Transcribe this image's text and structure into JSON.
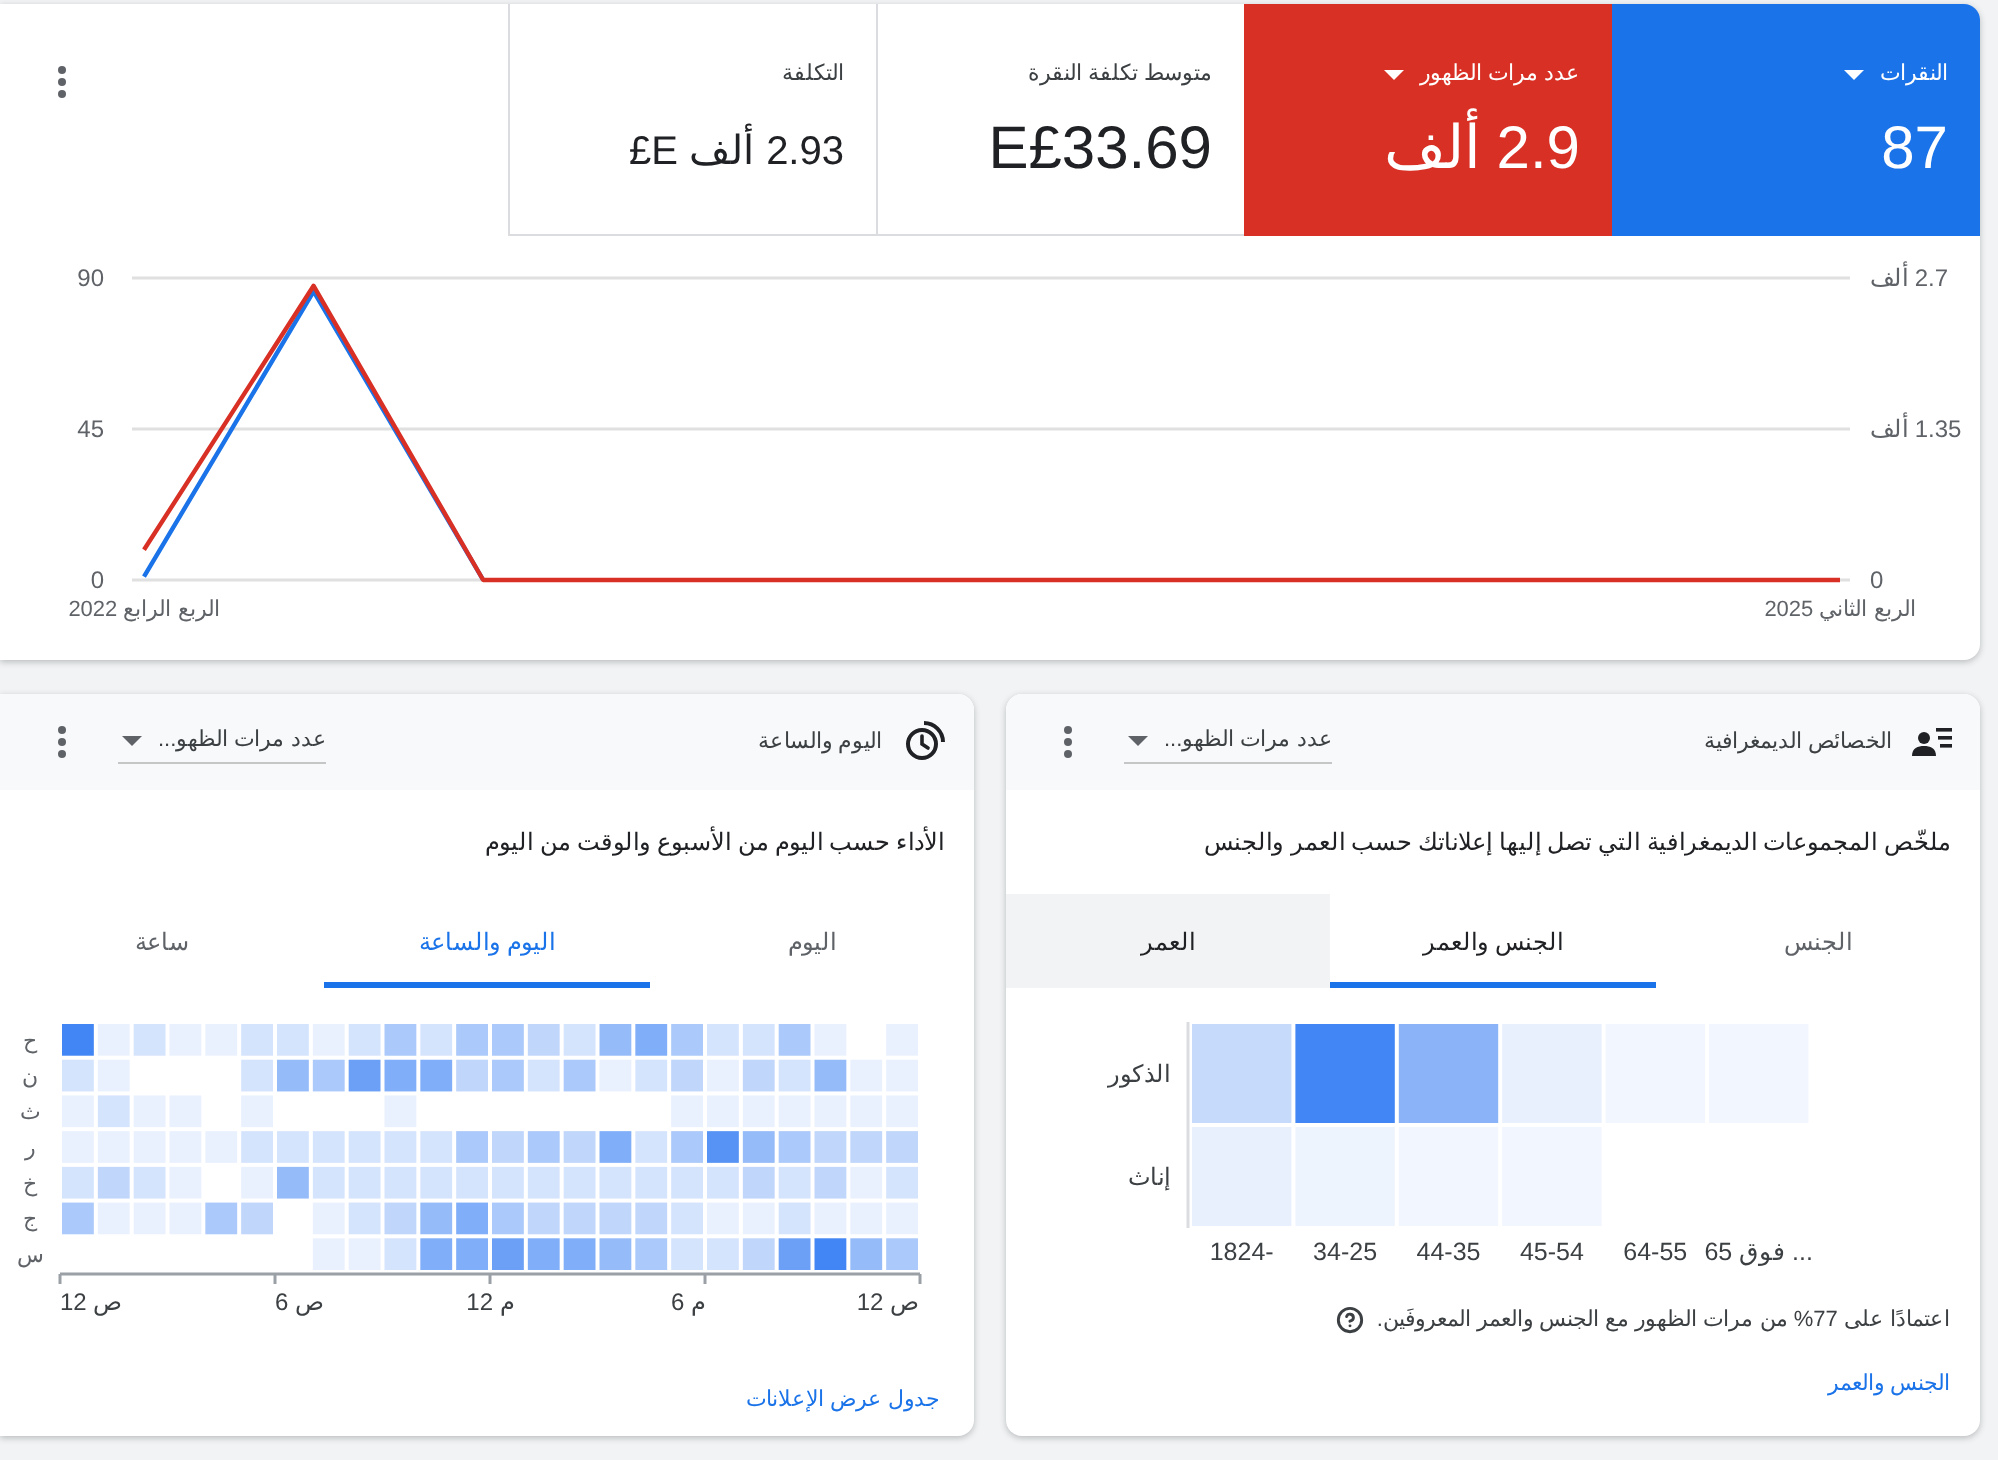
{
  "overview": {
    "metrics": [
      {
        "label": "النقرات",
        "value": "87",
        "selected": true,
        "color": "#1a73e8"
      },
      {
        "label": "عدد مرات الظهور",
        "value": "2.9 ألف",
        "selected": true,
        "color": "#d93025"
      },
      {
        "label": "متوسط تكلفة النقرة",
        "value": "E£33.69",
        "selected": false
      },
      {
        "label": "التكلفة",
        "value": "2.93 ألف E£",
        "selected": false
      }
    ],
    "chart_data": {
      "type": "line",
      "categories": [
        "الربع الرابع 2022",
        null,
        null,
        null,
        null,
        null,
        null,
        null,
        null,
        null,
        "الربع الثاني 2025"
      ],
      "ylim": [
        0,
        90
      ],
      "yticks": [
        0,
        45,
        90
      ],
      "y2lim": [
        0,
        2.7
      ],
      "y2ticks": [
        0,
        {
          "value": 1.35,
          "label": "1.35 ألف"
        },
        {
          "value": 2.7,
          "label": "2.7 ألف"
        }
      ],
      "series": [
        {
          "color": "#1a73e8",
          "values": [
            1,
            86,
            0,
            null,
            null,
            null,
            null,
            null,
            null,
            null,
            null
          ]
        },
        {
          "color": "#d93025",
          "axis": "y2",
          "values": [
            0.27,
            2.63,
            0,
            0,
            0,
            0,
            0,
            0,
            0,
            0,
            0
          ]
        }
      ]
    }
  },
  "demographics": {
    "title": "الخصائص الديمغرافية",
    "metric_dropdown": "عدد مرات الظهو...",
    "description": "ملخّص المجموعات الديمغرافية التي تصل إليها إعلاناتك حسب العمر والجنس",
    "tabs": [
      {
        "label": "الجنس",
        "selected": false,
        "hovered": false
      },
      {
        "label": "الجنس والعمر",
        "selected": true,
        "hovered": false
      },
      {
        "label": "العمر",
        "selected": false,
        "hovered": true
      }
    ],
    "gender_labels": [
      "الذكور",
      "إناث"
    ],
    "age_labels": [
      "65 فوق ...",
      "64-55",
      "45-54",
      "44-35",
      "34-25",
      "1824-"
    ],
    "footnote": "اعتمادًا على 77% من مرات الظهور مع الجنس والعمر المعروفَين.",
    "link": "الجنس والعمر"
  },
  "day_and_hour": {
    "title": "اليوم والساعة",
    "metric_dropdown": "عدد مرات الظهو...",
    "description": "الأداء حسب اليوم من الأسبوع والوقت من اليوم",
    "tabs": [
      {
        "label": "اليوم",
        "selected": false
      },
      {
        "label": "اليوم والساعة",
        "selected": true
      },
      {
        "label": "ساعة",
        "selected": false
      }
    ],
    "day_labels": [
      "ح",
      "ن",
      "ث",
      "ر",
      "خ",
      "ج",
      "س"
    ],
    "hour_labels": [
      "12 ص",
      "6 م",
      "12 م",
      "6 ص",
      "12 ص"
    ],
    "link": "جدول عرض الإعلانات"
  }
}
